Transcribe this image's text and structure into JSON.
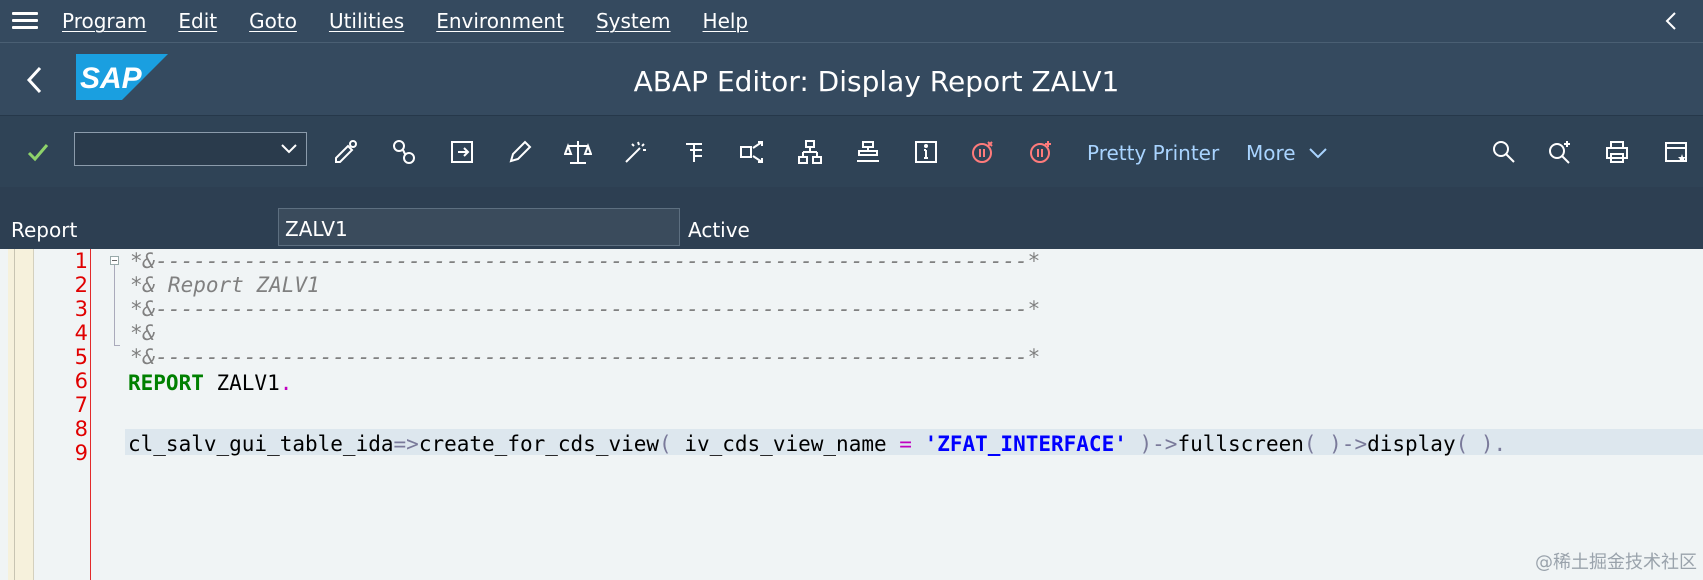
{
  "menubar": {
    "items": [
      "Program",
      "Edit",
      "Goto",
      "Utilities",
      "Environment",
      "System",
      "Help"
    ]
  },
  "titlebar": {
    "logo_text": "SAP",
    "title": "ABAP Editor: Display Report ZALV1"
  },
  "toolbar": {
    "combo_value": "",
    "pretty_printer_label": "Pretty Printer",
    "more_label": "More",
    "icons": [
      "check-icon",
      "display-change-icon",
      "active-inactive-icon",
      "other-object-icon",
      "edit-icon",
      "check-syntax-icon",
      "activate-icon",
      "test-icon",
      "where-used-icon",
      "object-list-icon",
      "navigation-window-icon",
      "info-icon",
      "set-breakpoint-icon",
      "session-breakpoint-icon",
      "search-icon",
      "search-next-icon",
      "print-icon",
      "customize-layout-icon"
    ]
  },
  "header": {
    "report_label": "Report",
    "report_value": "ZALV1",
    "status": "Active"
  },
  "editor": {
    "line_numbers": [
      "1",
      "2",
      "3",
      "4",
      "5",
      "6",
      "7",
      "8",
      "9"
    ],
    "lines": {
      "l1": "*&---------------------------------------------------------------------*",
      "l2": "*& Report ZALV1",
      "l3": "*&---------------------------------------------------------------------*",
      "l4": "*&",
      "l5": "*&---------------------------------------------------------------------*",
      "l6_kw": "REPORT",
      "l6_rest": " ZALV1",
      "l6_dot": ".",
      "l9_a": "cl_salv_gui_table_ida",
      "l9_b": "=>",
      "l9_c": "create_for_cds_view",
      "l9_d": "( ",
      "l9_e": "iv_cds_view_name ",
      "l9_f": "= ",
      "l9_g": "'ZFAT_INTERFACE'",
      "l9_h": " )->",
      "l9_i": "fullscreen",
      "l9_j": "( )->",
      "l9_k": "display",
      "l9_l": "( ).",
      "l9_m": ""
    }
  },
  "watermark": "@稀土掘金技术社区",
  "colors": {
    "shell_bg": "#354a5f",
    "toolbar_bg": "#2f4356",
    "link_blue": "#a9d4ff",
    "sap_blue": "#1a9fe0",
    "line_number_red": "#e00000"
  }
}
